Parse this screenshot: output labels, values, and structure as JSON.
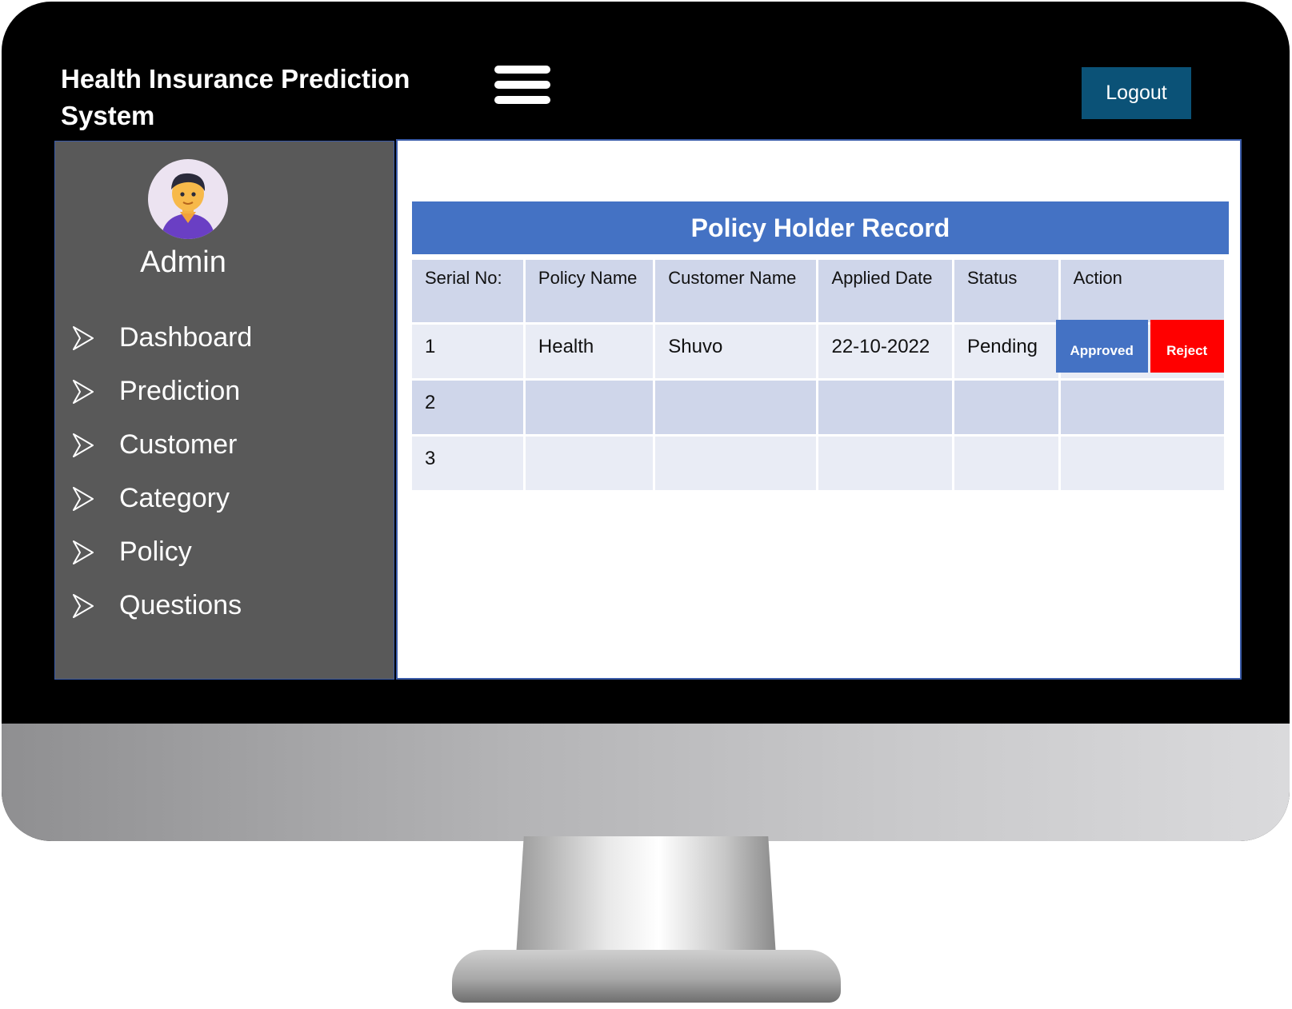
{
  "header": {
    "app_title": "Health Insurance Prediction System",
    "logout_label": "Logout"
  },
  "sidebar": {
    "user_label": "Admin",
    "items": [
      {
        "label": "Dashboard"
      },
      {
        "label": "Prediction"
      },
      {
        "label": "Customer"
      },
      {
        "label": "Category"
      },
      {
        "label": "Policy"
      },
      {
        "label": "Questions"
      }
    ]
  },
  "main": {
    "title": "Policy Holder Record",
    "columns": [
      "Serial No:",
      "Policy Name",
      "Customer Name",
      "Applied Date",
      "Status",
      "Action"
    ],
    "rows": [
      {
        "serial": "1",
        "policy": "Health",
        "customer": "Shuvo",
        "date": "22-10-2022",
        "status": "Pending",
        "approve_label": "Approved",
        "reject_label": "Reject"
      },
      {
        "serial": "2",
        "policy": "",
        "customer": "",
        "date": "",
        "status": ""
      },
      {
        "serial": "3",
        "policy": "",
        "customer": "",
        "date": "",
        "status": ""
      }
    ]
  },
  "colors": {
    "title_bar": "#4472c4",
    "sidebar": "#595959",
    "logout": "#0b5277",
    "approve": "#4472c4",
    "reject": "#ff0000"
  },
  "icons": [
    "hamburger-menu-icon",
    "avatar-icon",
    "arrow-right-icon"
  ]
}
